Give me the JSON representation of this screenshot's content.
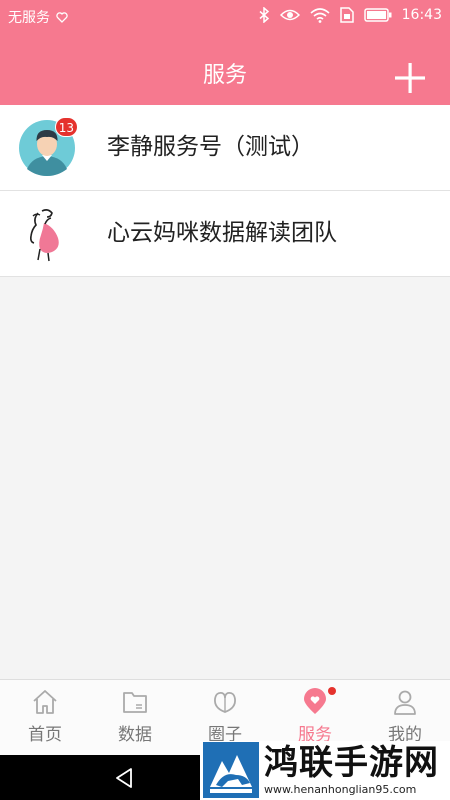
{
  "status_bar": {
    "carrier": "无服务",
    "time": "16:43",
    "icons": [
      "heart-outline-icon",
      "bluetooth-icon",
      "eye-icon",
      "wifi-icon",
      "sim-icon",
      "battery-icon"
    ]
  },
  "header": {
    "title": "服务",
    "add_icon": "plus-icon"
  },
  "services": [
    {
      "name": "李静服务号（测试）",
      "badge": "13",
      "avatar": "male-avatar-icon"
    },
    {
      "name": "心云妈咪数据解读团队",
      "avatar": "pregnant-woman-icon"
    }
  ],
  "tabs": [
    {
      "label": "首页",
      "icon": "home-icon",
      "active": false
    },
    {
      "label": "数据",
      "icon": "folder-icon",
      "active": false
    },
    {
      "label": "圈子",
      "icon": "circles-icon",
      "active": false
    },
    {
      "label": "服务",
      "icon": "location-heart-icon",
      "active": true,
      "dot": true
    },
    {
      "label": "我的",
      "icon": "person-icon",
      "active": false
    }
  ],
  "system_nav": {
    "back_icon": "back-triangle-icon"
  },
  "watermark": {
    "title": "鸿联手游网",
    "url": "www.henanhonglian95.com",
    "logo": "bull-logo"
  },
  "colors": {
    "brand": "#f6798f",
    "badge": "#e5322d",
    "inactive_tab": "#777777"
  }
}
